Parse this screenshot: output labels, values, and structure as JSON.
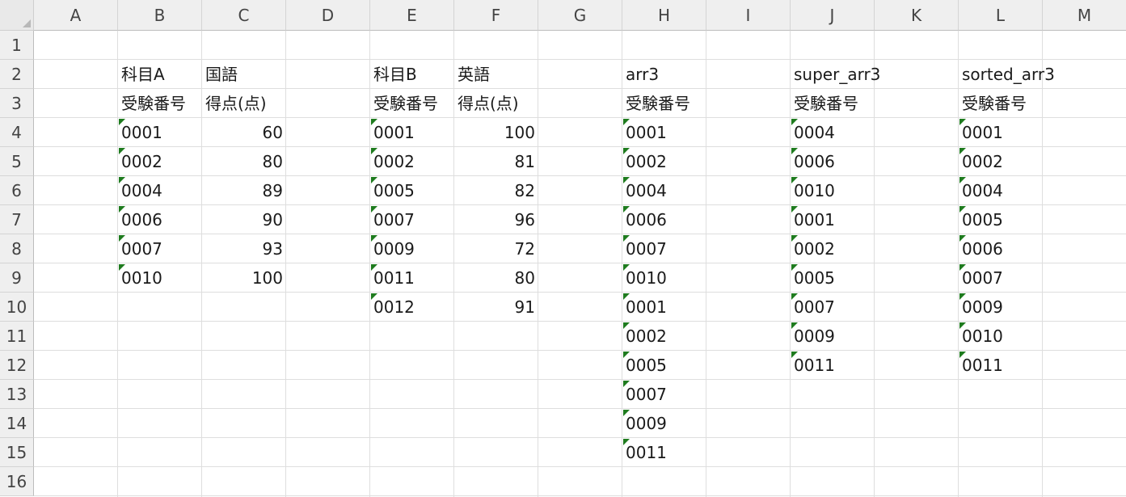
{
  "columns": [
    "A",
    "B",
    "C",
    "D",
    "E",
    "F",
    "G",
    "H",
    "I",
    "J",
    "K",
    "L",
    "M"
  ],
  "rows": [
    "1",
    "2",
    "3",
    "4",
    "5",
    "6",
    "7",
    "8",
    "9",
    "10",
    "11",
    "12",
    "13",
    "14",
    "15",
    "16"
  ],
  "cells": [
    {
      "ref": "B2",
      "value": "科目A",
      "type": "text"
    },
    {
      "ref": "C2",
      "value": "国語",
      "type": "text"
    },
    {
      "ref": "E2",
      "value": "科目B",
      "type": "text"
    },
    {
      "ref": "F2",
      "value": "英語",
      "type": "text"
    },
    {
      "ref": "H2",
      "value": "arr3",
      "type": "text"
    },
    {
      "ref": "J2",
      "value": "super_arr3",
      "type": "text"
    },
    {
      "ref": "L2",
      "value": "sorted_arr3",
      "type": "text"
    },
    {
      "ref": "B3",
      "value": "受験番号",
      "type": "text"
    },
    {
      "ref": "C3",
      "value": "得点(点)",
      "type": "text"
    },
    {
      "ref": "E3",
      "value": "受験番号",
      "type": "text"
    },
    {
      "ref": "F3",
      "value": "得点(点)",
      "type": "text"
    },
    {
      "ref": "H3",
      "value": "受験番号",
      "type": "text"
    },
    {
      "ref": "J3",
      "value": "受験番号",
      "type": "text"
    },
    {
      "ref": "L3",
      "value": "受験番号",
      "type": "text"
    },
    {
      "ref": "B4",
      "value": "0001",
      "type": "textnum"
    },
    {
      "ref": "B5",
      "value": "0002",
      "type": "textnum"
    },
    {
      "ref": "B6",
      "value": "0004",
      "type": "textnum"
    },
    {
      "ref": "B7",
      "value": "0006",
      "type": "textnum"
    },
    {
      "ref": "B8",
      "value": "0007",
      "type": "textnum"
    },
    {
      "ref": "B9",
      "value": "0010",
      "type": "textnum"
    },
    {
      "ref": "C4",
      "value": "60",
      "type": "number"
    },
    {
      "ref": "C5",
      "value": "80",
      "type": "number"
    },
    {
      "ref": "C6",
      "value": "89",
      "type": "number"
    },
    {
      "ref": "C7",
      "value": "90",
      "type": "number"
    },
    {
      "ref": "C8",
      "value": "93",
      "type": "number"
    },
    {
      "ref": "C9",
      "value": "100",
      "type": "number"
    },
    {
      "ref": "E4",
      "value": "0001",
      "type": "textnum"
    },
    {
      "ref": "E5",
      "value": "0002",
      "type": "textnum"
    },
    {
      "ref": "E6",
      "value": "0005",
      "type": "textnum"
    },
    {
      "ref": "E7",
      "value": "0007",
      "type": "textnum"
    },
    {
      "ref": "E8",
      "value": "0009",
      "type": "textnum"
    },
    {
      "ref": "E9",
      "value": "0011",
      "type": "textnum"
    },
    {
      "ref": "E10",
      "value": "0012",
      "type": "textnum"
    },
    {
      "ref": "F4",
      "value": "100",
      "type": "number"
    },
    {
      "ref": "F5",
      "value": "81",
      "type": "number"
    },
    {
      "ref": "F6",
      "value": "82",
      "type": "number"
    },
    {
      "ref": "F7",
      "value": "96",
      "type": "number"
    },
    {
      "ref": "F8",
      "value": "72",
      "type": "number"
    },
    {
      "ref": "F9",
      "value": "80",
      "type": "number"
    },
    {
      "ref": "F10",
      "value": "91",
      "type": "number"
    },
    {
      "ref": "H4",
      "value": "0001",
      "type": "textnum"
    },
    {
      "ref": "H5",
      "value": "0002",
      "type": "textnum"
    },
    {
      "ref": "H6",
      "value": "0004",
      "type": "textnum"
    },
    {
      "ref": "H7",
      "value": "0006",
      "type": "textnum"
    },
    {
      "ref": "H8",
      "value": "0007",
      "type": "textnum"
    },
    {
      "ref": "H9",
      "value": "0010",
      "type": "textnum"
    },
    {
      "ref": "H10",
      "value": "0001",
      "type": "textnum"
    },
    {
      "ref": "H11",
      "value": "0002",
      "type": "textnum"
    },
    {
      "ref": "H12",
      "value": "0005",
      "type": "textnum"
    },
    {
      "ref": "H13",
      "value": "0007",
      "type": "textnum"
    },
    {
      "ref": "H14",
      "value": "0009",
      "type": "textnum"
    },
    {
      "ref": "H15",
      "value": "0011",
      "type": "textnum"
    },
    {
      "ref": "J4",
      "value": "0004",
      "type": "textnum"
    },
    {
      "ref": "J5",
      "value": "0006",
      "type": "textnum"
    },
    {
      "ref": "J6",
      "value": "0010",
      "type": "textnum"
    },
    {
      "ref": "J7",
      "value": "0001",
      "type": "textnum"
    },
    {
      "ref": "J8",
      "value": "0002",
      "type": "textnum"
    },
    {
      "ref": "J9",
      "value": "0005",
      "type": "textnum"
    },
    {
      "ref": "J10",
      "value": "0007",
      "type": "textnum"
    },
    {
      "ref": "J11",
      "value": "0009",
      "type": "textnum"
    },
    {
      "ref": "J12",
      "value": "0011",
      "type": "textnum"
    },
    {
      "ref": "L4",
      "value": "0001",
      "type": "textnum"
    },
    {
      "ref": "L5",
      "value": "0002",
      "type": "textnum"
    },
    {
      "ref": "L6",
      "value": "0004",
      "type": "textnum"
    },
    {
      "ref": "L7",
      "value": "0005",
      "type": "textnum"
    },
    {
      "ref": "L8",
      "value": "0006",
      "type": "textnum"
    },
    {
      "ref": "L9",
      "value": "0007",
      "type": "textnum"
    },
    {
      "ref": "L10",
      "value": "0009",
      "type": "textnum"
    },
    {
      "ref": "L11",
      "value": "0010",
      "type": "textnum"
    },
    {
      "ref": "L12",
      "value": "0011",
      "type": "textnum"
    }
  ],
  "colors": {
    "error_flag": "#1e7b1e",
    "header_bg": "#efefef",
    "gridline": "#dedede"
  }
}
